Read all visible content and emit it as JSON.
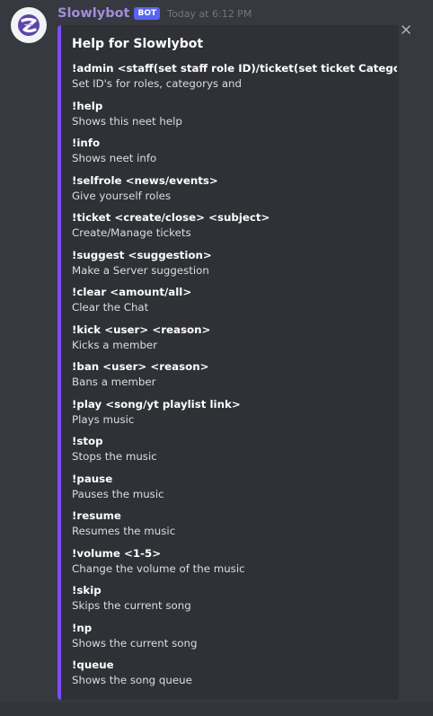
{
  "message": {
    "username": "Slowlybot",
    "bot_tag": "BOT",
    "timestamp": "Today at 6:12 PM"
  },
  "embed": {
    "accent_color": "#7c4dff",
    "title": "Help for Slowlybot",
    "fields": [
      {
        "name": "!admin <staff(set staff role ID)/ticket(set ticket Category ID)>",
        "value": "Set ID's for roles, categorys and"
      },
      {
        "name": "!help",
        "value": "Shows this neet help"
      },
      {
        "name": "!info",
        "value": "Shows neet info"
      },
      {
        "name": "!selfrole <news/events>",
        "value": "Give yourself roles"
      },
      {
        "name": "!ticket <create/close> <subject>",
        "value": "Create/Manage tickets"
      },
      {
        "name": "!suggest <suggestion>",
        "value": "Make a Server suggestion"
      },
      {
        "name": "!clear <amount/all>",
        "value": "Clear the Chat"
      },
      {
        "name": "!kick <user> <reason>",
        "value": "Kicks a member"
      },
      {
        "name": "!ban <user> <reason>",
        "value": "Bans a member"
      },
      {
        "name": "!play <song/yt playlist link>",
        "value": "Plays music"
      },
      {
        "name": "!stop",
        "value": "Stops the music"
      },
      {
        "name": "!pause",
        "value": "Pauses the music"
      },
      {
        "name": "!resume",
        "value": "Resumes the music"
      },
      {
        "name": "!volume <1-5>",
        "value": "Change the volume of the music"
      },
      {
        "name": "!skip",
        "value": "Skips the current song"
      },
      {
        "name": "!np",
        "value": "Shows the current song"
      },
      {
        "name": "!queue",
        "value": "Shows the song queue"
      }
    ]
  },
  "icons": {
    "avatar": "slowlybot-logo-icon",
    "close": "close-icon"
  }
}
